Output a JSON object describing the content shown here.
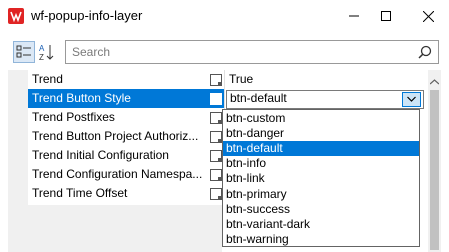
{
  "window": {
    "title": "wf-popup-info-layer",
    "icon": "app-icon",
    "min_label": "—",
    "max_label": "☐",
    "close_label": "✕"
  },
  "toolbar": {
    "categorized_icon": "categorized-icon",
    "alpha_icon": "alphabetical-sort-icon",
    "search_placeholder": "Search",
    "search_value": ""
  },
  "grid": {
    "rows": [
      {
        "name": "Trend",
        "value": "True"
      },
      {
        "name": "Trend Button Style",
        "value": "btn-default"
      },
      {
        "name": "Trend Postfixes",
        "value": ""
      },
      {
        "name": "Trend Button Project Authoriz...",
        "value": ""
      },
      {
        "name": "Trend Initial Configuration",
        "value": ""
      },
      {
        "name": "Trend Configuration Namespa...",
        "value": ""
      },
      {
        "name": "Trend Time Offset",
        "value": ""
      }
    ],
    "selected_index": 1
  },
  "dropdown": {
    "options": [
      "btn-custom",
      "btn-danger",
      "btn-default",
      "btn-info",
      "btn-link",
      "btn-primary",
      "btn-success",
      "btn-variant-dark",
      "btn-warning"
    ],
    "selected_index": 2
  },
  "colors": {
    "accent": "#0078d7",
    "title_icon": "#e02424"
  }
}
